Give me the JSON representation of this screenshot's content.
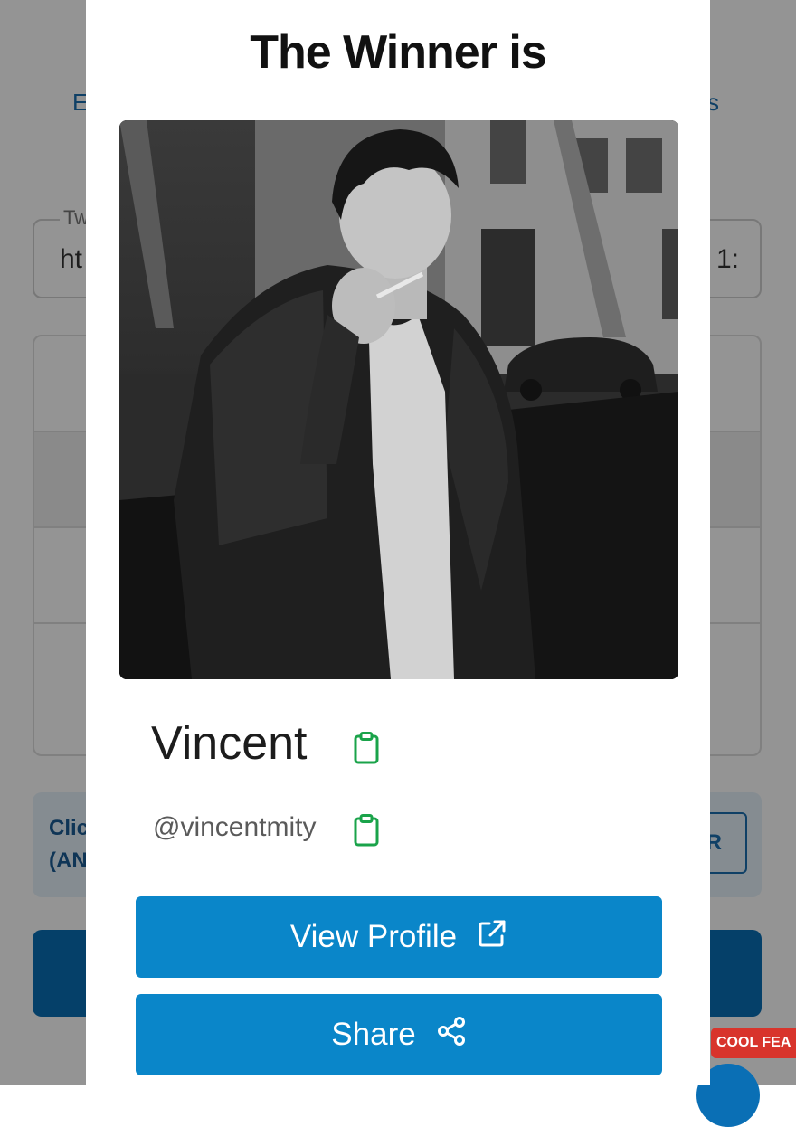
{
  "background": {
    "nav_left_fragment": "E",
    "nav_right_fragment": "s",
    "field_label_fragment": "Tw",
    "field_value_left_fragment": "ht",
    "field_value_right_fragment": "1:",
    "notice_line1_fragment": "Clic",
    "notice_line2_fragment": "(AN",
    "notice_button_fragment": "OR"
  },
  "badge": {
    "label": "COOL FEA"
  },
  "modal": {
    "title": "The Winner is",
    "winner": {
      "name": "Vincent",
      "handle": "@vincentmity"
    },
    "buttons": {
      "view_profile": "View Profile",
      "share": "Share"
    }
  },
  "icons": {
    "copy": "clipboard-icon",
    "external": "external-link-icon",
    "share": "share-icon"
  },
  "colors": {
    "primary_button": "#0a86c9",
    "copy_icon": "#1aa34a",
    "badge": "#d8342c",
    "overlay": "rgba(0,0,0,0.42)"
  }
}
